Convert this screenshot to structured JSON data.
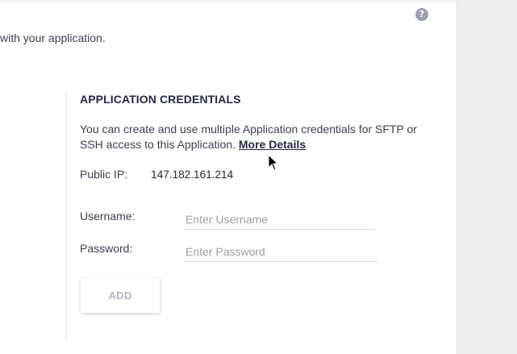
{
  "header": {
    "help_icon": "help-circle-icon",
    "help_symbol": "?"
  },
  "intro": {
    "text": "with your application."
  },
  "credentials": {
    "title": "APPLICATION CREDENTIALS",
    "description": "You can create and use multiple Application credentials for SFTP or SSH access to this Application.",
    "more_details_link": "More Details",
    "public_ip_label": "Public IP:",
    "public_ip_value": "147.182.161.214",
    "username_label": "Username:",
    "username_placeholder": "Enter Username",
    "username_value": "",
    "password_label": "Password:",
    "password_placeholder": "Enter Password",
    "password_value": "",
    "add_button_label": "ADD"
  },
  "colors": {
    "text_dark": "#1f2a44",
    "text_muted": "#3a4256",
    "placeholder": "#9aa0ab",
    "button_text_disabled": "#b3b7c2",
    "right_panel_bg": "#efeff1"
  }
}
